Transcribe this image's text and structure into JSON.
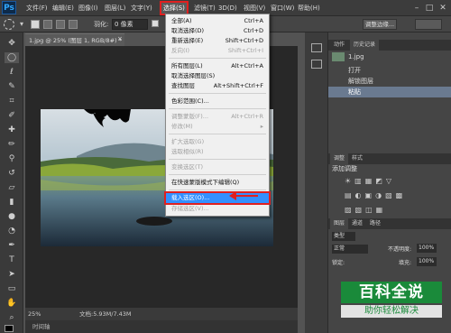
{
  "app": {
    "logo": "Ps"
  },
  "menubar": {
    "items": [
      "文件(F)",
      "编辑(E)",
      "图像(I)",
      "图层(L)",
      "文字(Y)",
      "选择(S)",
      "滤镜(T)",
      "3D(D)",
      "视图(V)",
      "窗口(W)",
      "帮助(H)"
    ]
  },
  "options": {
    "feather_label": "羽化:",
    "feather_value": "0 像素",
    "refine_label": "调整边缘..."
  },
  "document": {
    "tab_title": "1.jpg @ 25% (图层 1, RGB/8#) *",
    "zoom": "25%",
    "doc_info": "文档:5.93M/7.43M",
    "timeline_label": "时间轴"
  },
  "select_menu": {
    "items": [
      {
        "label": "全部(A)",
        "shortcut": "Ctrl+A",
        "enabled": true
      },
      {
        "label": "取消选择(D)",
        "shortcut": "Ctrl+D",
        "enabled": true
      },
      {
        "label": "重新选择(E)",
        "shortcut": "Shift+Ctrl+D",
        "enabled": true
      },
      {
        "label": "反向(I)",
        "shortcut": "Shift+Ctrl+I",
        "enabled": false
      },
      {
        "label": "所有图层(L)",
        "shortcut": "Alt+Ctrl+A",
        "enabled": true
      },
      {
        "label": "取消选择图层(S)",
        "shortcut": "",
        "enabled": true
      },
      {
        "label": "查找图层",
        "shortcut": "Alt+Shift+Ctrl+F",
        "enabled": true
      },
      {
        "label": "色彩范围(C)...",
        "shortcut": "",
        "enabled": true
      },
      {
        "label": "调整蒙版(F)...",
        "shortcut": "Alt+Ctrl+R",
        "enabled": false
      },
      {
        "label": "修改(M)",
        "shortcut": "",
        "enabled": false
      },
      {
        "label": "扩大选取(G)",
        "shortcut": "",
        "enabled": false
      },
      {
        "label": "选取相似(R)",
        "shortcut": "",
        "enabled": false
      },
      {
        "label": "变换选区(T)",
        "shortcut": "",
        "enabled": false
      },
      {
        "label": "在快速蒙版模式下编辑(Q)",
        "shortcut": "",
        "enabled": true
      },
      {
        "label": "载入选区(O)...",
        "shortcut": "",
        "enabled": true
      },
      {
        "label": "存储选区(V)...",
        "shortcut": "",
        "enabled": false
      }
    ]
  },
  "history_panel": {
    "tabs": [
      "动作",
      "历史记录"
    ],
    "items": [
      "1.jpg",
      "打开",
      "解锁图层",
      "粘贴"
    ]
  },
  "adjust_panel": {
    "tabs": [
      "调整",
      "样式"
    ],
    "title": "添加调整"
  },
  "layers_panel": {
    "tabs": [
      "图层",
      "通道",
      "路径"
    ],
    "kind_label": "类型",
    "blend_mode": "正常",
    "opacity_label": "不透明度:",
    "opacity_value": "100%",
    "lock_label": "锁定:",
    "fill_label": "填充:",
    "fill_value": "100%"
  },
  "watermark": {
    "main": "百科全说",
    "sub": "助你轻松解决"
  },
  "colors": {
    "highlight": "#3390ff",
    "annotation_red": "#e02020"
  }
}
